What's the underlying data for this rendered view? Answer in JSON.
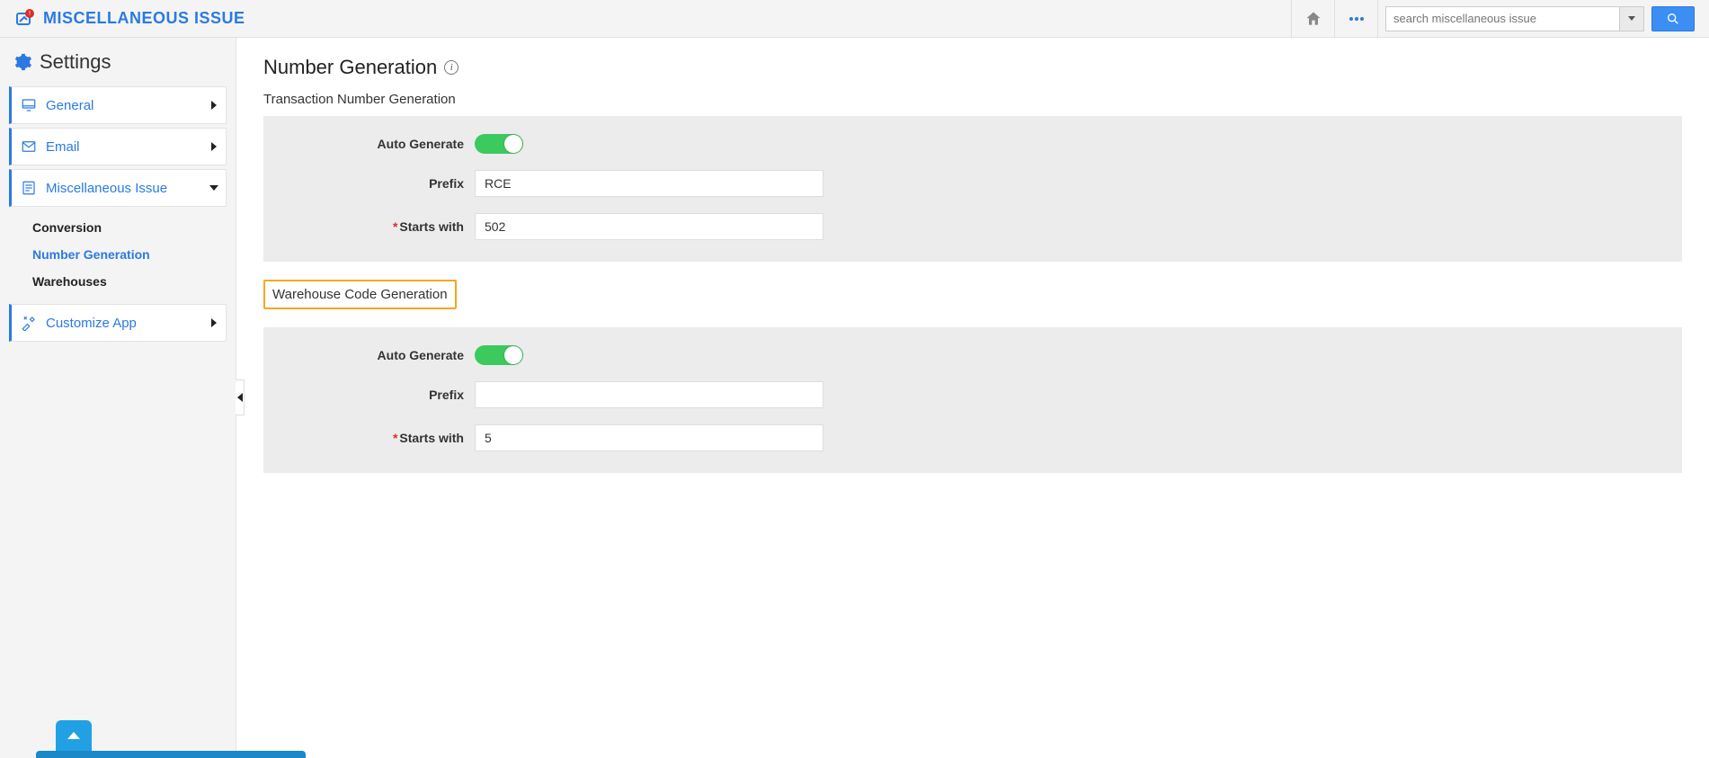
{
  "header": {
    "app_title": "MISCELLANEOUS ISSUE",
    "search_placeholder": "search miscellaneous issue"
  },
  "sidebar": {
    "title": "Settings",
    "items": [
      {
        "label": "General",
        "icon": "monitor",
        "expanded": false
      },
      {
        "label": "Email",
        "icon": "envelope",
        "expanded": false
      },
      {
        "label": "Miscellaneous Issue",
        "icon": "form",
        "expanded": true,
        "children": [
          {
            "label": "Conversion",
            "active": false
          },
          {
            "label": "Number Generation",
            "active": true
          },
          {
            "label": "Warehouses",
            "active": false
          }
        ]
      },
      {
        "label": "Customize App",
        "icon": "tools",
        "expanded": false
      }
    ]
  },
  "page": {
    "title": "Number Generation",
    "info_char": "i",
    "sections": [
      {
        "key": "transaction",
        "heading": "Transaction Number Generation",
        "highlight": false,
        "auto_generate_label": "Auto Generate",
        "auto_generate": true,
        "prefix_label": "Prefix",
        "prefix_value": "RCE",
        "starts_with_label": "Starts with",
        "starts_with_required": true,
        "starts_with_value": "502"
      },
      {
        "key": "warehouse",
        "heading": "Warehouse Code Generation",
        "highlight": true,
        "auto_generate_label": "Auto Generate",
        "auto_generate": true,
        "prefix_label": "Prefix",
        "prefix_value": "",
        "starts_with_label": "Starts with",
        "starts_with_required": true,
        "starts_with_value": "5"
      }
    ]
  }
}
